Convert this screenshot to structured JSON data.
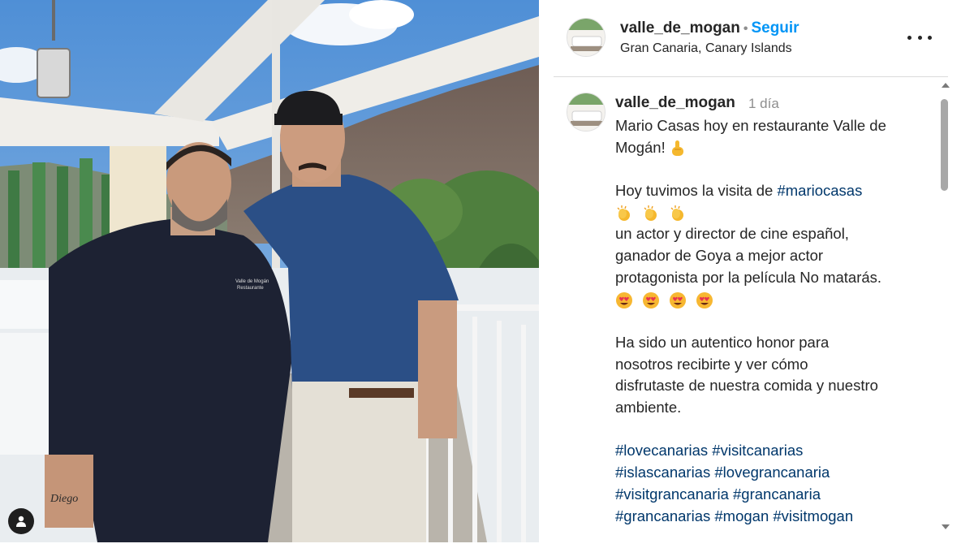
{
  "post": {
    "username": "valle_de_mogan",
    "follow_label": "Seguir",
    "separator": "•",
    "location": "Gran Canaria, Canary Islands"
  },
  "caption": {
    "username": "valle_de_mogan",
    "time": "1 día",
    "intro_line1": "Mario Casas hoy en restaurante Valle de",
    "intro_line2": "Mogán!",
    "visit_text": "Hoy tuvimos la visita de ",
    "visit_hashtag": "#mariocasas",
    "desc_line1": "un actor y director de cine español,",
    "desc_line2": "ganador de Goya a mejor actor",
    "desc_line3": "protagonista por la película No matarás.",
    "honor_line1": "Ha sido un autentico honor para",
    "honor_line2": "nosotros recibirte y ver cómo",
    "honor_line3": "disfrutaste de nuestra comida y nuestro",
    "honor_line4": "ambiente.",
    "hashtags": [
      [
        "#lovecanarias",
        "#visitcanarias"
      ],
      [
        "#islascanarias",
        "#lovegrancanaria"
      ],
      [
        "#visitgrancanaria",
        "#grancanaria"
      ],
      [
        "#grancanarias",
        "#mogan",
        "#visitmogan"
      ]
    ]
  },
  "photo": {
    "tattoo_text": "Diego",
    "chef_jacket_text_1": "Valle de Mogán",
    "chef_jacket_text_2": "Restaurante"
  },
  "colors": {
    "follow": "#0095f6",
    "hashtag": "#00376b",
    "time": "#8e8e8e"
  },
  "icons": {
    "more": "more-options-icon",
    "user_tag": "user-tag-icon",
    "emoji_point": "pointing-up-emoji",
    "emoji_clap": "clapping-hands-emoji",
    "emoji_heart_eyes": "heart-eyes-emoji"
  }
}
